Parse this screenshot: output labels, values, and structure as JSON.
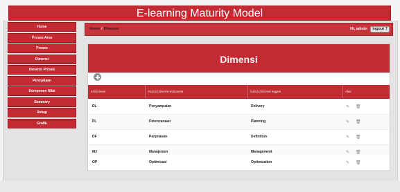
{
  "app": {
    "title": "E-learning Maturity Model"
  },
  "sidebar": {
    "items": [
      {
        "label": "Home"
      },
      {
        "label": "Proses Area"
      },
      {
        "label": "Proses"
      },
      {
        "label": "Dimensi"
      },
      {
        "label": "Dimensi Proses"
      },
      {
        "label": "Pernyataan"
      },
      {
        "label": "Komponen Nilai"
      },
      {
        "label": "Summary"
      },
      {
        "label": "Rekap"
      },
      {
        "label": "Grafik"
      }
    ]
  },
  "topbar": {
    "breadcrumb": [
      "Home",
      "Dimensi"
    ],
    "greeting": "Hi, admin",
    "logout_label": "logout ?"
  },
  "panel": {
    "title": "Dimensi",
    "add_icon": "plus-circle-icon",
    "columns": [
      "Id Dimensi",
      "Nama Dimensi Indonesia",
      "Nama Dimensi Inggris",
      "Aksi"
    ],
    "rows": [
      {
        "id": "DL",
        "indonesia": "Penyampaian",
        "inggris": "Delivery"
      },
      {
        "id": "PL",
        "indonesia": "Perencanaan",
        "inggris": "Planning"
      },
      {
        "id": "DF",
        "indonesia": "Penjelasan",
        "inggris": "Definition"
      },
      {
        "id": "MJ",
        "indonesia": "Manajemen",
        "inggris": "Management"
      },
      {
        "id": "OP",
        "indonesia": "Optimisasi",
        "inggris": "Optimization"
      }
    ],
    "action_icons": [
      "pencil-edit-icon",
      "trash-delete-icon"
    ]
  },
  "colors": {
    "accent": "#c32a32",
    "background": "#e3e3e3"
  }
}
